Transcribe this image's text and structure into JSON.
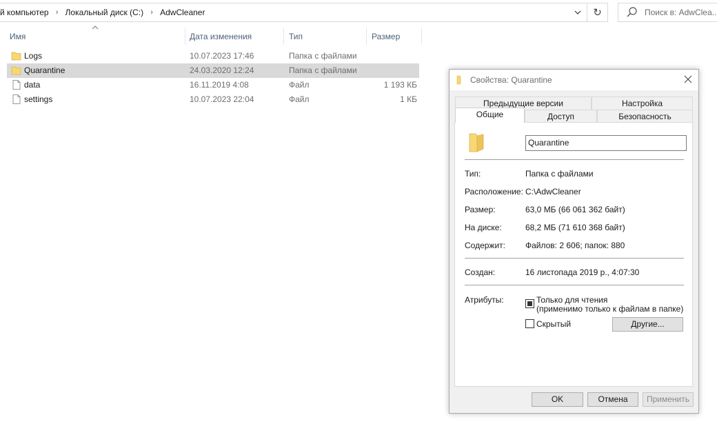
{
  "address": {
    "crumbs": [
      "й компьютер",
      "Локальный диск (C:)",
      "AdwCleaner"
    ],
    "search_placeholder": "Поиск в: AdwClea..."
  },
  "columns": {
    "name": "Имя",
    "date": "Дата изменения",
    "type": "Тип",
    "size": "Размер"
  },
  "files": [
    {
      "name": "Logs",
      "date": "10.07.2023 17:46",
      "type": "Папка с файлами",
      "size": "",
      "icon": "folder-icon",
      "selected": false
    },
    {
      "name": "Quarantine",
      "date": "24.03.2020 12:24",
      "type": "Папка с файлами",
      "size": "",
      "icon": "folder-icon",
      "selected": true
    },
    {
      "name": "data",
      "date": "16.11.2019 4:08",
      "type": "Файл",
      "size": "1 193 КБ",
      "icon": "file-icon",
      "selected": false
    },
    {
      "name": "settings",
      "date": "10.07.2023 22:04",
      "type": "Файл",
      "size": "1 КБ",
      "icon": "file-icon",
      "selected": false
    }
  ],
  "dialog": {
    "title": "Свойства: Quarantine",
    "tabs_row1": [
      "Предыдущие версии",
      "Настройка"
    ],
    "tabs_row2": [
      "Общие",
      "Доступ",
      "Безопасность"
    ],
    "active_tab": "Общие",
    "folder_name": "Quarantine",
    "props": {
      "type_label": "Тип:",
      "type_value": "Папка с файлами",
      "location_label": "Расположение:",
      "location_value": "C:\\AdwCleaner",
      "size_label": "Размер:",
      "size_value": "63,0 МБ (66 061 362 байт)",
      "disk_label": "На диске:",
      "disk_value": "68,2 МБ (71 610 368 байт)",
      "contains_label": "Содержит:",
      "contains_value": "Файлов: 2 606; папок: 880",
      "created_label": "Создан:",
      "created_value": "16 листопада 2019 р., 4:07:30",
      "attributes_label": "Атрибуты:"
    },
    "readonly_label": "Только для чтения",
    "readonly_note": "(применимо только к файлам в папке)",
    "readonly_state": "indeterminate",
    "hidden_label": "Скрытый",
    "hidden_checked": false,
    "other_button": "Другие...",
    "ok_button": "OK",
    "cancel_button": "Отмена",
    "apply_button": "Применить"
  },
  "colors": {
    "selection": "#d9d9d9",
    "folder": "#f8d775",
    "header_text": "#4c607a"
  }
}
